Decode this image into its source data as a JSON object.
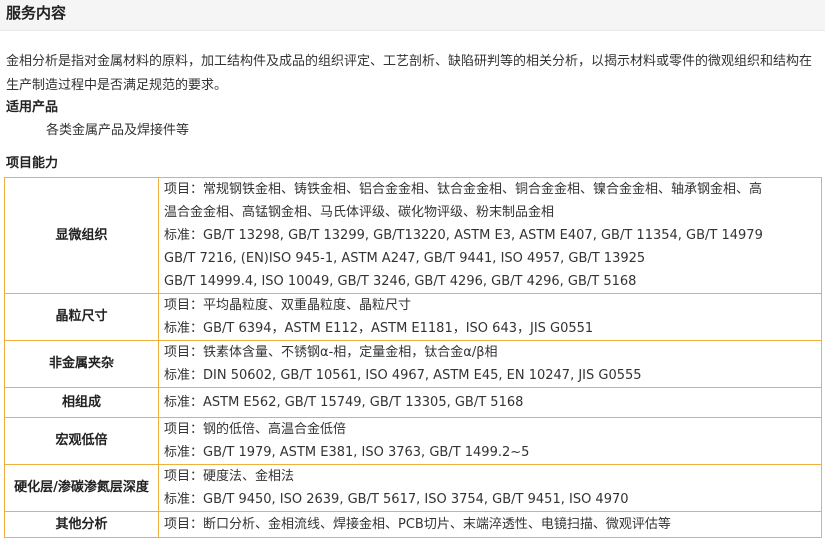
{
  "header": {
    "title": "服务内容"
  },
  "intro": "金相分析是指对金属材料的原料，加工结构件及成品的组织评定、工艺剖析、缺陷研判等的相关分析，以揭示材料或零件的微观组织和结构在生产制造过程中是否满足规范的要求。",
  "applicable": {
    "heading": "适用产品",
    "text": "各类金属产品及焊接件等"
  },
  "capabilities": {
    "heading": "项目能力",
    "rows": [
      {
        "name": "显微组织",
        "lines": [
          "项目：常规钢铁金相、铸铁金相、铝合金金相、钛合金金相、铜合金金相、镍合金金相、轴承钢金相、高",
          "温合金金相、高锰钢金相、马氏体评级、碳化物评级、粉末制品金相",
          "标准：GB/T 13298, GB/T 13299, GB/T13220, ASTM E3, ASTM E407, GB/T 11354, GB/T 14979",
          "GB/T 7216,  (EN)ISO 945-1, ASTM A247, GB/T 9441, ISO 4957, GB/T 13925",
          "GB/T 14999.4, ISO 10049, GB/T 3246, GB/T 4296, GB/T 4296, GB/T 5168"
        ]
      },
      {
        "name": "晶粒尺寸",
        "lines": [
          "项目：平均晶粒度、双重晶粒度、晶粒尺寸",
          "标准：GB/T 6394，ASTM E112，ASTM E1181，ISO 643，JIS G0551"
        ]
      },
      {
        "name": "非金属夹杂",
        "lines": [
          "项目：铁素体含量、不锈钢α-相，定量金相，钛合金α/β相",
          "标准：DIN 50602, GB/T 10561, ISO 4967, ASTM E45, EN 10247, JIS G0555"
        ]
      },
      {
        "name": "相组成",
        "lines": [
          "标准：ASTM E562, GB/T 15749, GB/T 13305, GB/T 5168"
        ]
      },
      {
        "name": "宏观低倍",
        "lines": [
          "项目：钢的低倍、高温合金低倍",
          "标准：GB/T 1979, ASTM E381, ISO 3763, GB/T 1499.2~5"
        ]
      },
      {
        "name": "硬化层/渗碳渗氮层深度",
        "lines": [
          "项目：硬度法、金相法",
          "标准：GB/T 9450, ISO 2639, GB/T 5617, ISO 3754, GB/T 9451, ISO 4970"
        ]
      },
      {
        "name": "其他分析",
        "lines": [
          "项目：断口分析、金相流线、焊接金相、PCB切片、末端淬透性、电镜扫描、微观评估等"
        ]
      }
    ]
  }
}
